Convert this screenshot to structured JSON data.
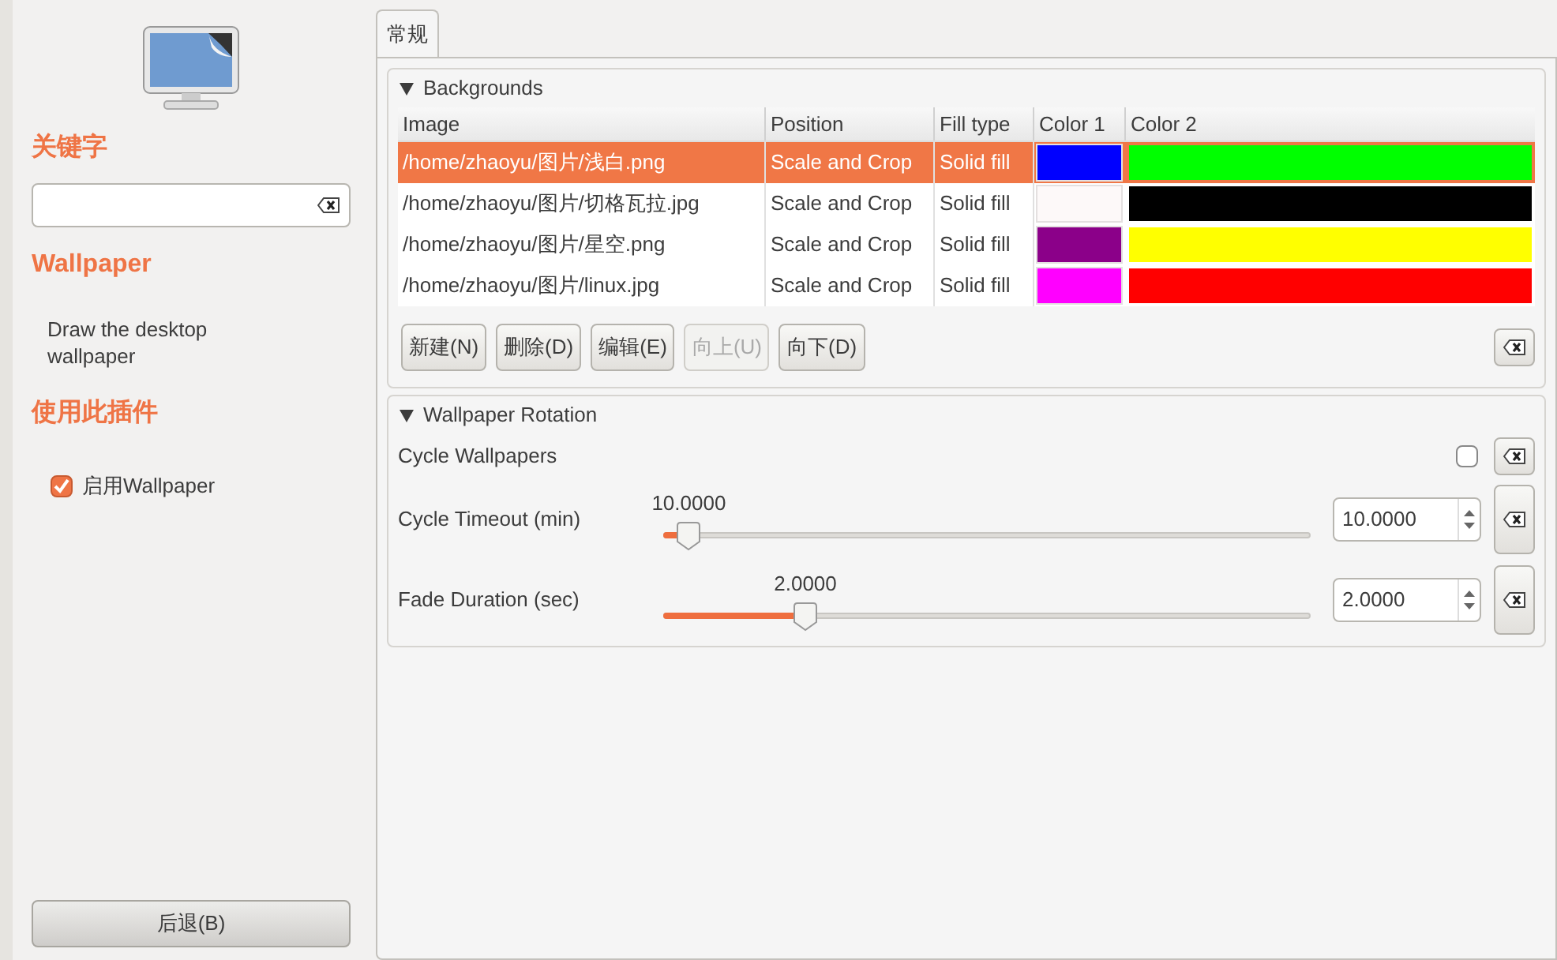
{
  "sidebar": {
    "keyword_heading": "关键字",
    "plugin_title": "Wallpaper",
    "plugin_description": "Draw the desktop wallpaper",
    "use_heading": "使用此插件",
    "enable": {
      "label": "启用Wallpaper",
      "checked": true
    },
    "back_button": "后退(B)"
  },
  "tabs": [
    {
      "label": "常规",
      "selected": true
    }
  ],
  "backgrounds": {
    "title": "Backgrounds",
    "expanded": true,
    "columns": [
      "Image",
      "Position",
      "Fill type",
      "Color 1",
      "Color 2"
    ],
    "rows": [
      {
        "image": "/home/zhaoyu/图片/浅白.png",
        "position": "Scale and Crop",
        "fill_type": "Solid fill",
        "swatches": [
          {
            "color": "#0000ff"
          },
          {
            "color": "#00ff00"
          }
        ],
        "selected": true
      },
      {
        "image": "/home/zhaoyu/图片/切格瓦拉.jpg",
        "position": "Scale and Crop",
        "fill_type": "Solid fill",
        "swatches": [
          {
            "color": "#fdf9f9"
          },
          {
            "color": "#000000"
          }
        ],
        "selected": false
      },
      {
        "image": "/home/zhaoyu/图片/星空.png",
        "position": "Scale and Crop",
        "fill_type": "Solid fill",
        "swatches": [
          {
            "color": "#8b0089"
          },
          {
            "color": "#ffff00"
          }
        ],
        "selected": false
      },
      {
        "image": "/home/zhaoyu/图片/linux.jpg",
        "position": "Scale and Crop",
        "fill_type": "Solid fill",
        "swatches": [
          {
            "color": "#ff00ff"
          },
          {
            "color": "#ff0000"
          }
        ],
        "selected": false
      }
    ],
    "buttons": [
      {
        "label": "新建(N)",
        "disabled": false
      },
      {
        "label": "删除(D)",
        "disabled": false
      },
      {
        "label": "编辑(E)",
        "disabled": false
      },
      {
        "label": "向上(U)",
        "disabled": true
      },
      {
        "label": "向下(D)",
        "disabled": false
      }
    ]
  },
  "rotation": {
    "title": "Wallpaper Rotation",
    "expanded": true,
    "settings": [
      {
        "kind": "checkbox",
        "label": "Cycle Wallpapers",
        "checked": false
      },
      {
        "kind": "slider",
        "label": "Cycle Timeout (min)",
        "reading": "10.0000",
        "level": 0.02,
        "value": "10.0000"
      },
      {
        "kind": "slider",
        "label": "Fade Duration (sec)",
        "reading": "2.0000",
        "level": 0.2,
        "value": "2.0000"
      }
    ]
  }
}
